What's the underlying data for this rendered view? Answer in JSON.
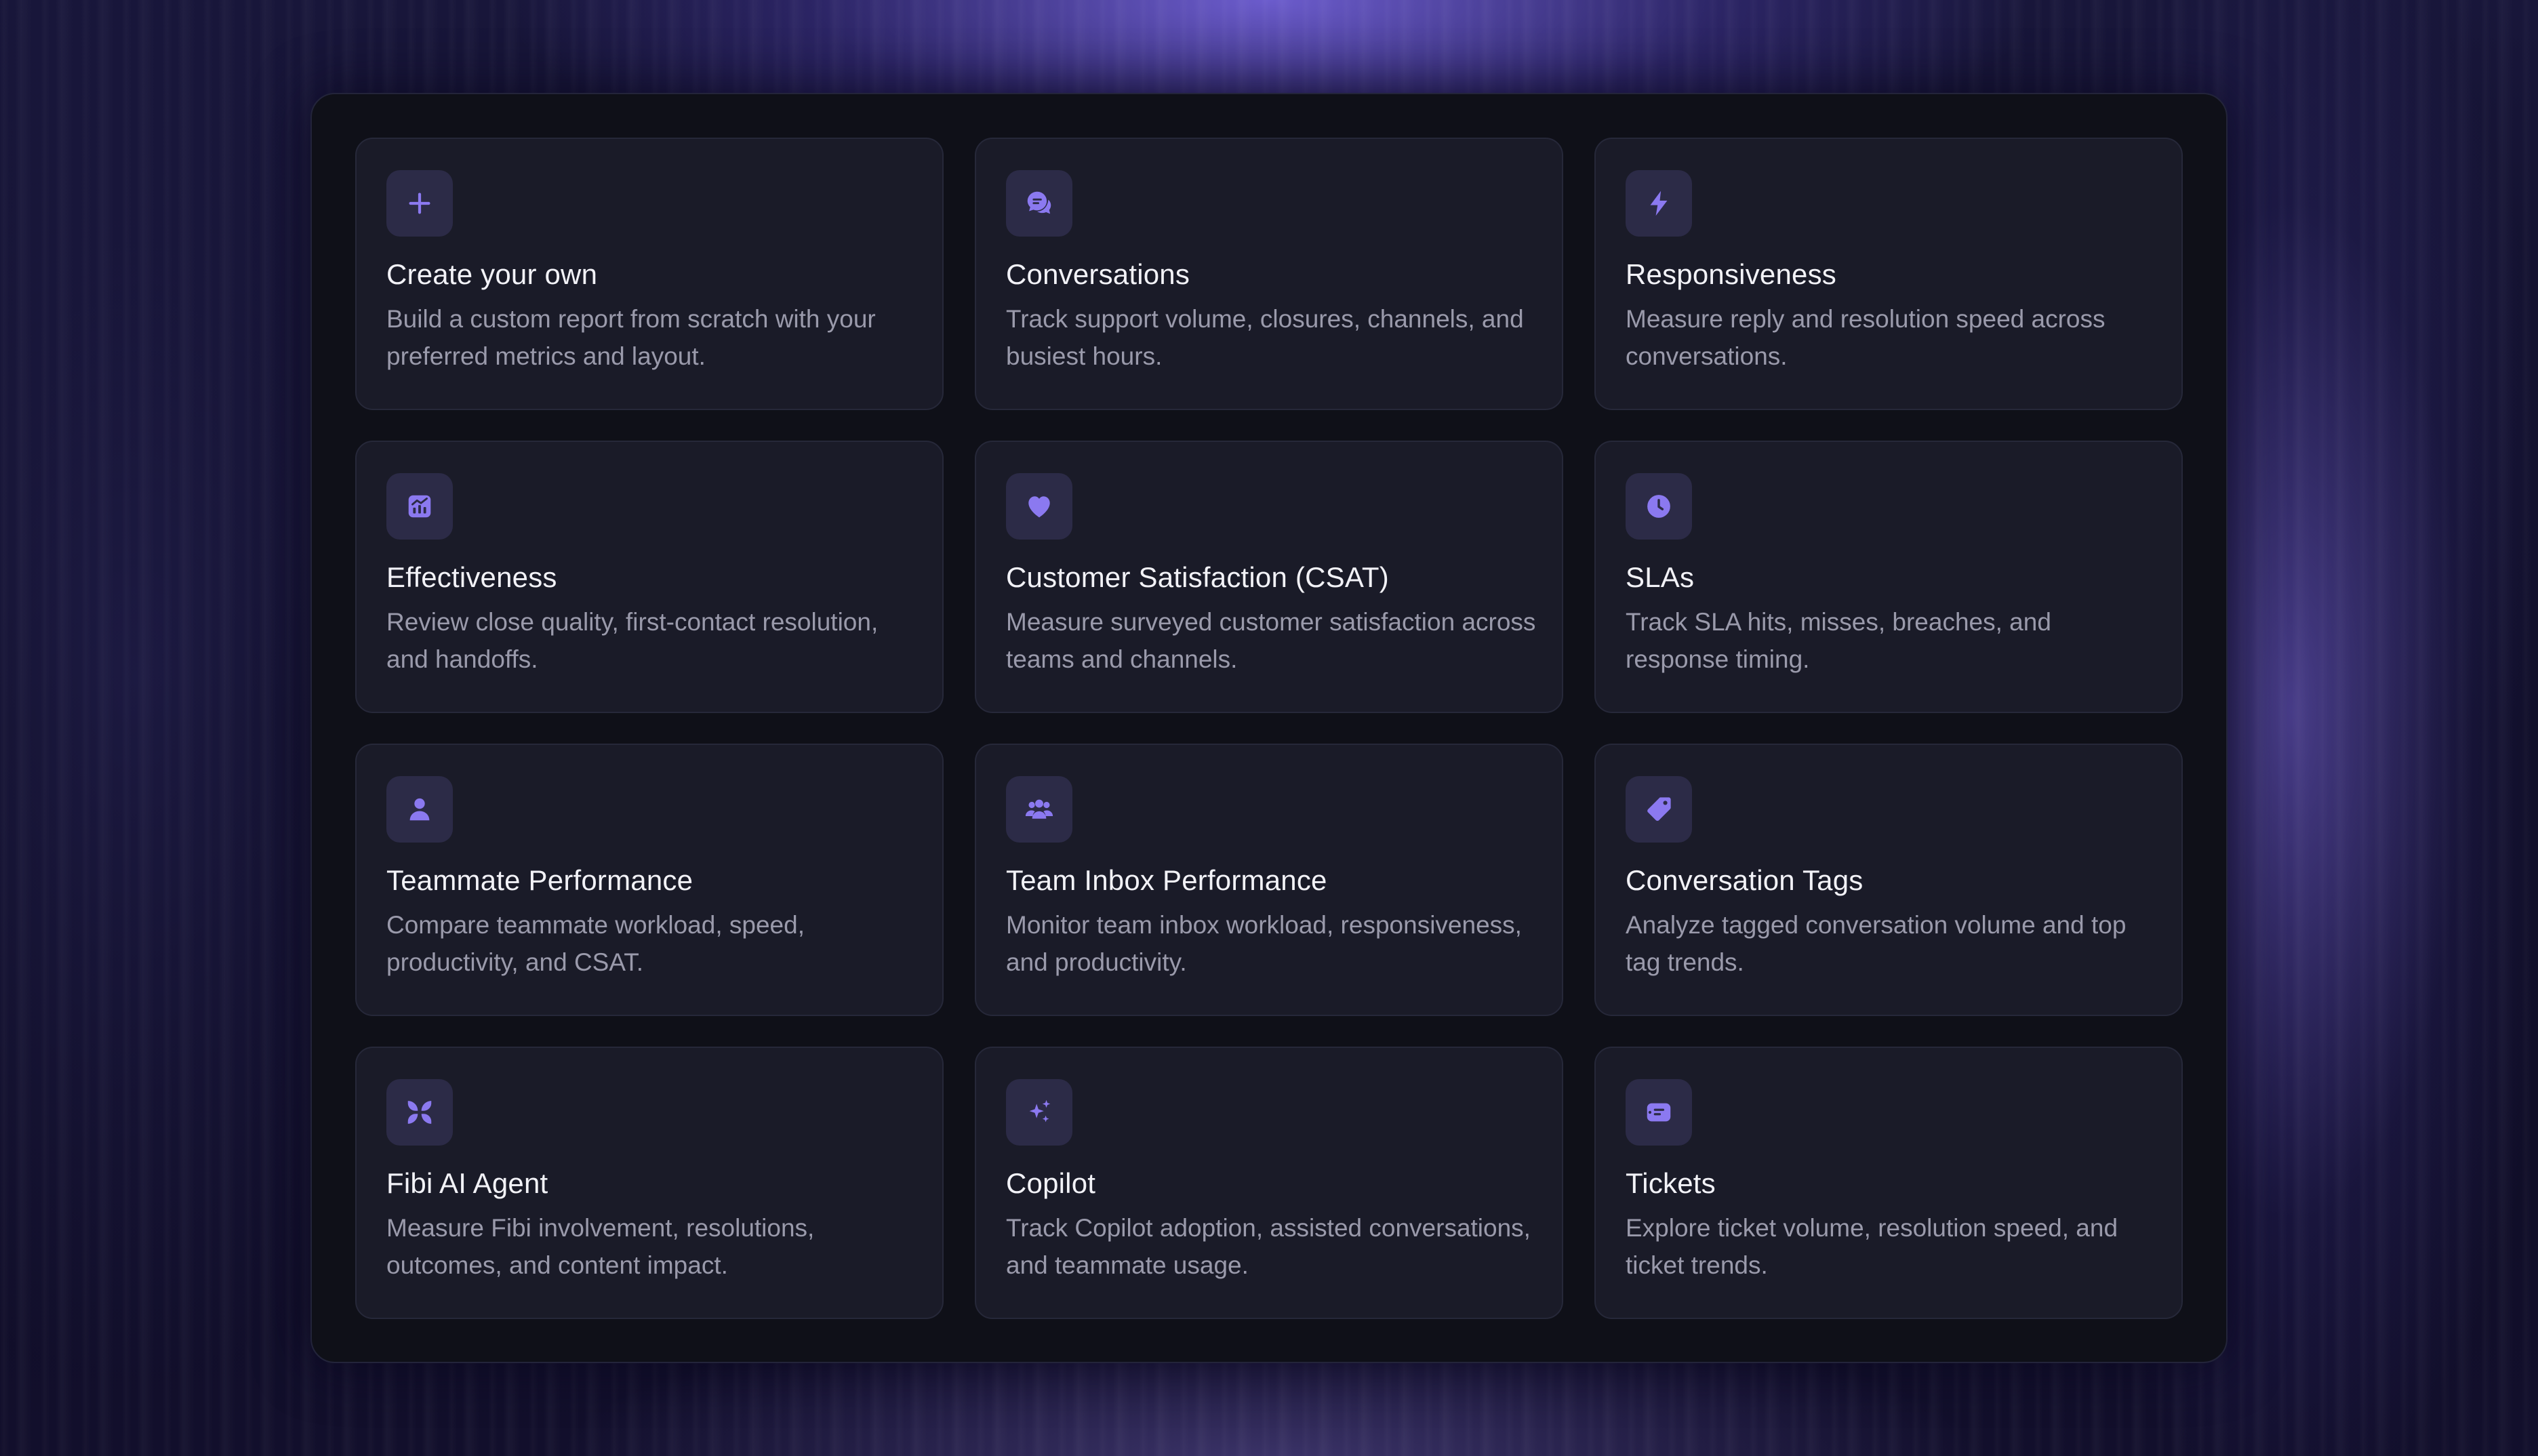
{
  "accent_color": "#8b79f0",
  "cards": [
    {
      "icon": "plus-icon",
      "title": "Create your own",
      "description": "Build a custom report from scratch with your preferred metrics and layout."
    },
    {
      "icon": "chat-bubbles-icon",
      "title": "Conversations",
      "description": "Track support volume, closures, channels, and busiest hours."
    },
    {
      "icon": "lightning-icon",
      "title": "Responsiveness",
      "description": "Measure reply and resolution speed across conversations."
    },
    {
      "icon": "chart-icon",
      "title": "Effectiveness",
      "description": "Review close quality, first-contact resolution, and handoffs."
    },
    {
      "icon": "heart-icon",
      "title": "Customer Satisfaction (CSAT)",
      "description": "Measure surveyed customer satisfaction across teams and channels."
    },
    {
      "icon": "clock-icon",
      "title": "SLAs",
      "description": "Track SLA hits, misses, breaches, and response timing."
    },
    {
      "icon": "user-icon",
      "title": "Teammate Performance",
      "description": "Compare teammate workload, speed, productivity, and CSAT."
    },
    {
      "icon": "users-icon",
      "title": "Team Inbox Performance",
      "description": "Monitor team inbox workload, responsiveness, and productivity."
    },
    {
      "icon": "tag-icon",
      "title": "Conversation Tags",
      "description": "Analyze tagged conversation volume and top tag trends."
    },
    {
      "icon": "fibi-agent-icon",
      "title": "Fibi AI Agent",
      "description": "Measure Fibi involvement, resolutions, outcomes, and content impact."
    },
    {
      "icon": "sparkles-icon",
      "title": "Copilot",
      "description": "Track Copilot adoption, assisted conversations, and teammate usage."
    },
    {
      "icon": "ticket-icon",
      "title": "Tickets",
      "description": "Explore ticket volume, resolution speed, and ticket trends."
    }
  ]
}
